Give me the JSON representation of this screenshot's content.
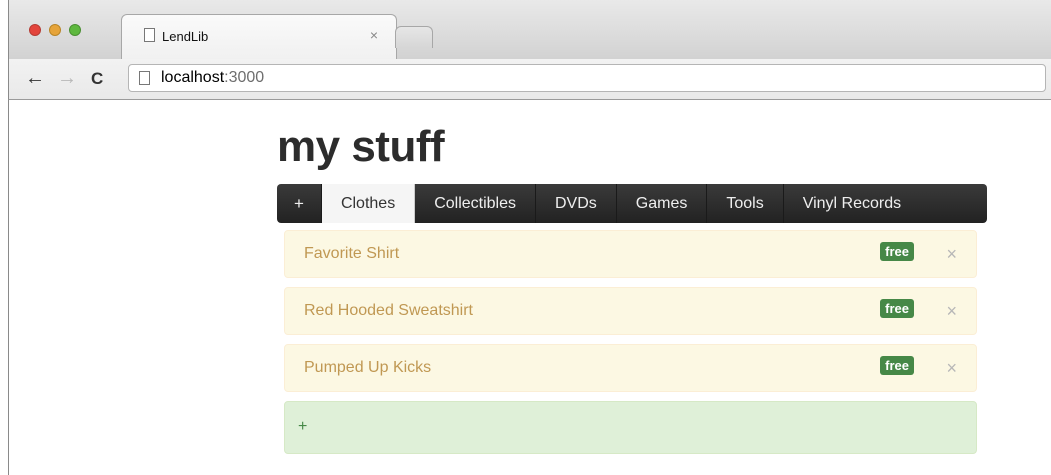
{
  "browser": {
    "tab_title": "LendLib",
    "tab_close": "×",
    "url_host": "localhost",
    "url_port": ":3000",
    "back_icon": "←",
    "forward_icon": "→",
    "reload_icon": "C"
  },
  "page": {
    "title": "my stuff",
    "nav": {
      "add_label": "+",
      "categories": [
        "Clothes",
        "Collectibles",
        "DVDs",
        "Games",
        "Tools",
        "Vinyl Records"
      ],
      "active": "Clothes"
    },
    "items": [
      {
        "name": "Favorite Shirt",
        "status": "free"
      },
      {
        "name": "Red Hooded Sweatshirt",
        "status": "free"
      },
      {
        "name": "Pumped Up Kicks",
        "status": "free"
      }
    ],
    "remove_label": "×",
    "add_item_label": "+"
  },
  "colors": {
    "item_bg": "#fcf8e3",
    "item_text": "#c09853",
    "badge": "#468847",
    "add_bg": "#dff0d8",
    "nav_bg": "#2b2b2b"
  }
}
